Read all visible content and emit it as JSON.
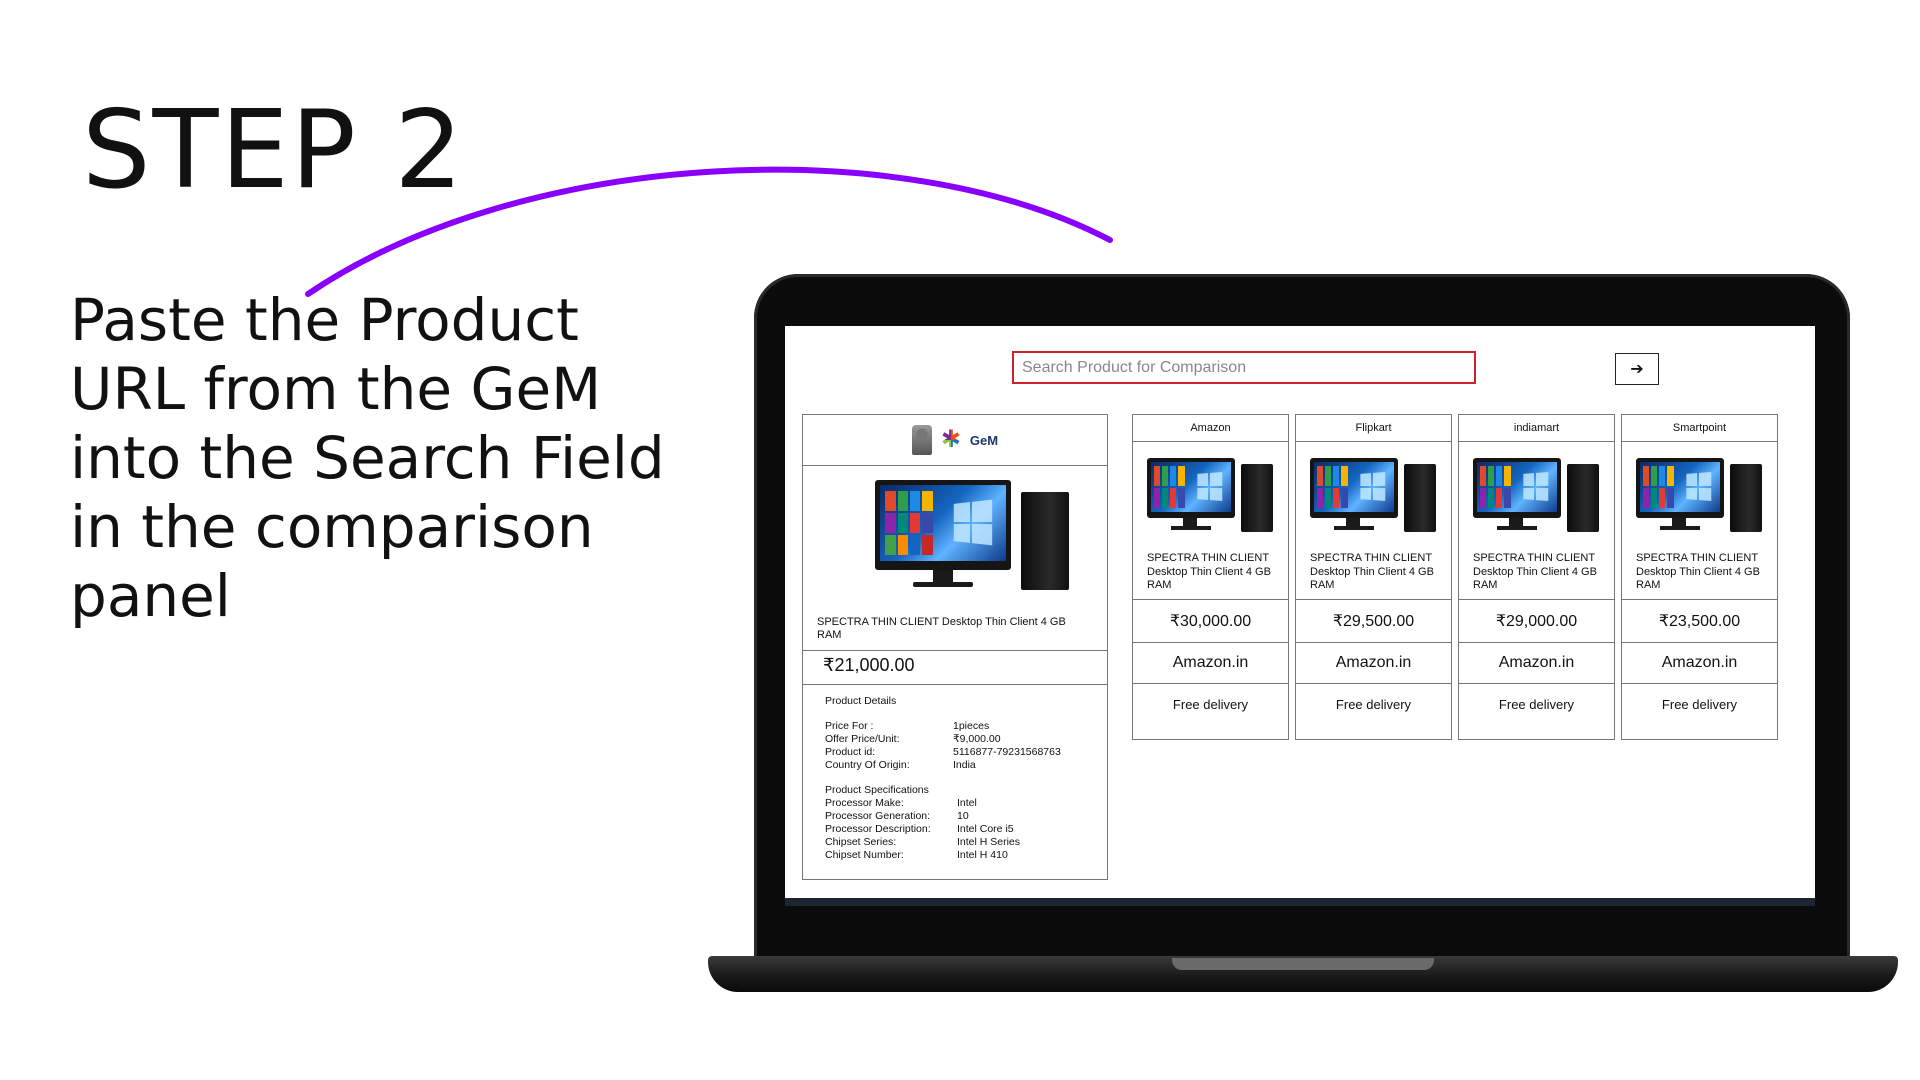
{
  "slide": {
    "step_title": "STEP 2",
    "instruction": "Paste the Product URL from the GeM into the Search Field in the comparison panel",
    "arrow_color": "#8a00ff"
  },
  "search": {
    "placeholder": "Search Product for Comparison",
    "border_color": "#d0202a"
  },
  "gem_card": {
    "logo_text": "GeM",
    "product_name": "SPECTRA THIN CLIENT Desktop Thin Client 4 GB RAM",
    "price": "₹21,000.00",
    "details_heading": "Product Details",
    "details": [
      {
        "label": "Price For :",
        "value": "1pieces"
      },
      {
        "label": "Offer Price/Unit:",
        "value": "₹9,000.00"
      },
      {
        "label": "Product id:",
        "value": "5116877-79231568763"
      },
      {
        "label": "Country Of Origin:",
        "value": " India"
      }
    ],
    "specs_heading": "Product Specifications",
    "specs": [
      {
        "label": "Processor Make:",
        "value": "Intel"
      },
      {
        "label": "Processor Generation:",
        "value": "10"
      },
      {
        "label": "Processor Description:",
        "value": "Intel Core i5"
      },
      {
        "label": "Chipset Series:",
        "value": "Intel H Series"
      },
      {
        "label": "Chipset Number:",
        "value": "Intel H 410"
      }
    ]
  },
  "vendors": [
    {
      "name": "Amazon",
      "description": "SPECTRA THIN CLIENT Desktop Thin Client 4 GB RAM",
      "price": "₹30,000.00",
      "seller": "Amazon.in",
      "delivery": "Free delivery"
    },
    {
      "name": "Flipkart",
      "description": "SPECTRA THIN CLIENT Desktop Thin Client 4 GB RAM",
      "price": "₹29,500.00",
      "seller": "Amazon.in",
      "delivery": "Free delivery"
    },
    {
      "name": "indiamart",
      "description": "SPECTRA THIN CLIENT Desktop Thin Client 4 GB RAM",
      "price": "₹29,000.00",
      "seller": "Amazon.in",
      "delivery": "Free delivery"
    },
    {
      "name": "Smartpoint",
      "description": "SPECTRA THIN CLIENT Desktop Thin Client 4 GB RAM",
      "price": "₹23,500.00",
      "seller": "Amazon.in",
      "delivery": "Free delivery"
    }
  ]
}
